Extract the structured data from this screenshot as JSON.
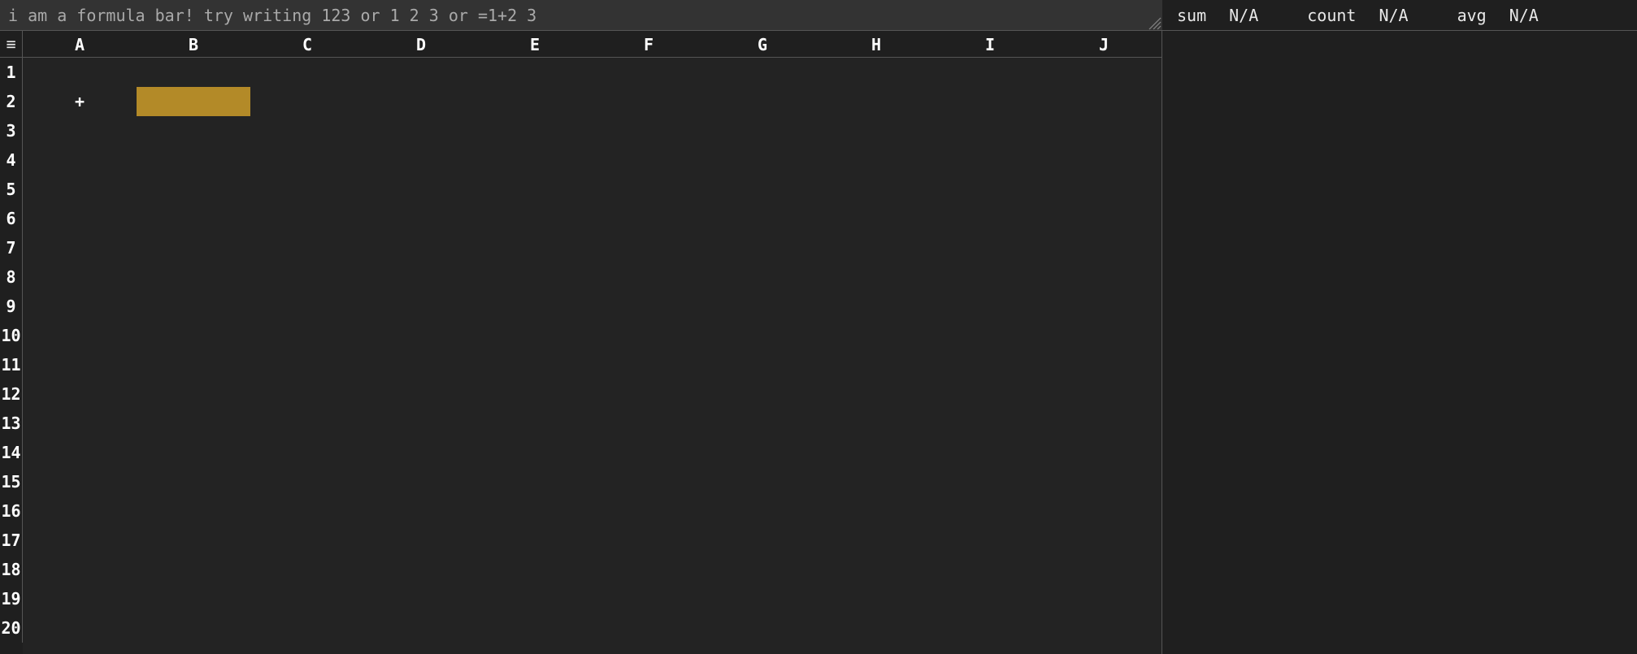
{
  "formula_bar": {
    "placeholder": "i am a formula bar! try writing 123 or 1 2 3 or =1+2 3",
    "value": ""
  },
  "stats": {
    "sum_label": "sum",
    "sum_value": "N/A",
    "count_label": "count",
    "count_value": "N/A",
    "avg_label": "avg",
    "avg_value": "N/A"
  },
  "corner_glyph": "≡",
  "columns": [
    "A",
    "B",
    "C",
    "D",
    "E",
    "F",
    "G",
    "H",
    "I",
    "J"
  ],
  "rows": [
    "1",
    "2",
    "3",
    "4",
    "5",
    "6",
    "7",
    "8",
    "9",
    "10",
    "11",
    "12",
    "13",
    "14",
    "15",
    "16",
    "17",
    "18",
    "19",
    "20"
  ],
  "cells": {
    "A2": "+"
  },
  "selected_cell": "B2"
}
